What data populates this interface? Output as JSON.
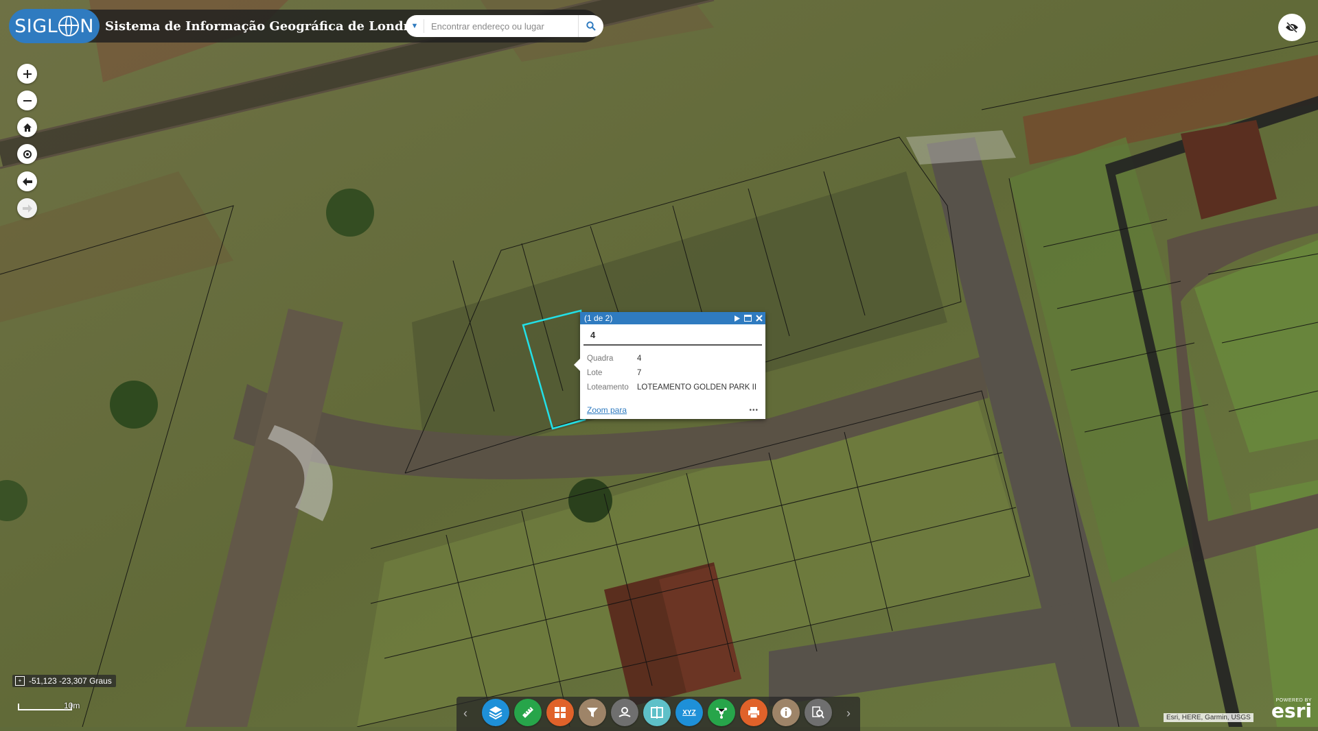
{
  "header": {
    "logo_text": "SIGLON",
    "logo_prefix": "SIGL",
    "logo_suffix": "N",
    "title": "Sistema de Informação Geográfica de Londrina",
    "search_placeholder": "Encontrar endereço ou lugar"
  },
  "nav": [
    {
      "name": "zoom-in-button",
      "icon": "plus-icon"
    },
    {
      "name": "zoom-out-button",
      "icon": "minus-icon"
    },
    {
      "name": "home-button",
      "icon": "home-icon"
    },
    {
      "name": "locate-button",
      "icon": "locate-icon"
    },
    {
      "name": "previous-extent-button",
      "icon": "arrow-left-icon"
    },
    {
      "name": "next-extent-button",
      "icon": "arrow-right-icon"
    }
  ],
  "popup": {
    "counter": "(1 de 2)",
    "title": "4",
    "fields": [
      {
        "label": "Quadra",
        "value": "4"
      },
      {
        "label": "Lote",
        "value": "7"
      },
      {
        "label": "Loteamento",
        "value": "LOTEAMENTO GOLDEN PARK II"
      }
    ],
    "zoom_link": "Zoom para",
    "more": "•••"
  },
  "coordinates": "-51,123 -23,307 Graus",
  "scale_label": "10m",
  "toolbar": [
    {
      "name": "layers-tool",
      "icon": "layers-icon",
      "color": "#1e90d8"
    },
    {
      "name": "measure-tool",
      "icon": "ruler-icon",
      "color": "#27a54a"
    },
    {
      "name": "basemap-tool",
      "icon": "grid-icon",
      "color": "#e0622a"
    },
    {
      "name": "query-tool",
      "icon": "filter-icon",
      "color": "#9e8468"
    },
    {
      "name": "draw-tool",
      "icon": "draw-icon",
      "color": "#6f6f6f"
    },
    {
      "name": "swipe-tool",
      "icon": "swipe-icon",
      "color": "#5ec0c8"
    },
    {
      "name": "coordinate-tool",
      "icon": "xyz-icon",
      "color": "#1e90d8"
    },
    {
      "name": "share-tool",
      "icon": "share-icon",
      "color": "#27a54a"
    },
    {
      "name": "print-tool",
      "icon": "print-icon",
      "color": "#e0622a"
    },
    {
      "name": "about-tool",
      "icon": "info-icon",
      "color": "#9e8468"
    },
    {
      "name": "search-tool",
      "icon": "search-doc-icon",
      "color": "#6f6f6f"
    }
  ],
  "toolbar_xyz_text": "XYZ",
  "attribution": "Esri, HERE, Garmin, USGS",
  "esri_logo": {
    "powered": "POWERED BY",
    "name": "esri"
  }
}
